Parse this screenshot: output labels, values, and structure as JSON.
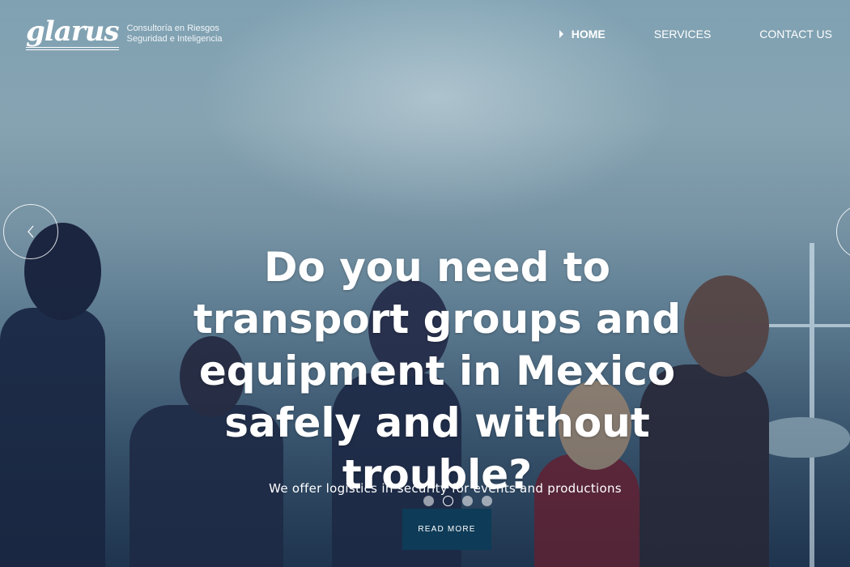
{
  "logo": {
    "mark": "glarus",
    "tagline_line1": "Consultoría en Riesgos",
    "tagline_line2": "Seguridad e Inteligencia"
  },
  "nav": {
    "items": [
      {
        "label": "HOME",
        "active": true
      },
      {
        "label": "SERVICES",
        "active": false
      },
      {
        "label": "CONTACT US",
        "active": false
      }
    ]
  },
  "slider": {
    "headline": "Do you need to transport groups and equipment in Mexico safely and without trouble?",
    "subtitle": "We offer logistics in security for events and productions",
    "button_label": "READ MORE",
    "prev_icon": "chevron-left-icon",
    "next_icon": "chevron-right-icon",
    "slide_count": 4,
    "active_slide": 2
  },
  "colors": {
    "button_bg": "#0e3b57",
    "text": "#ffffff"
  }
}
